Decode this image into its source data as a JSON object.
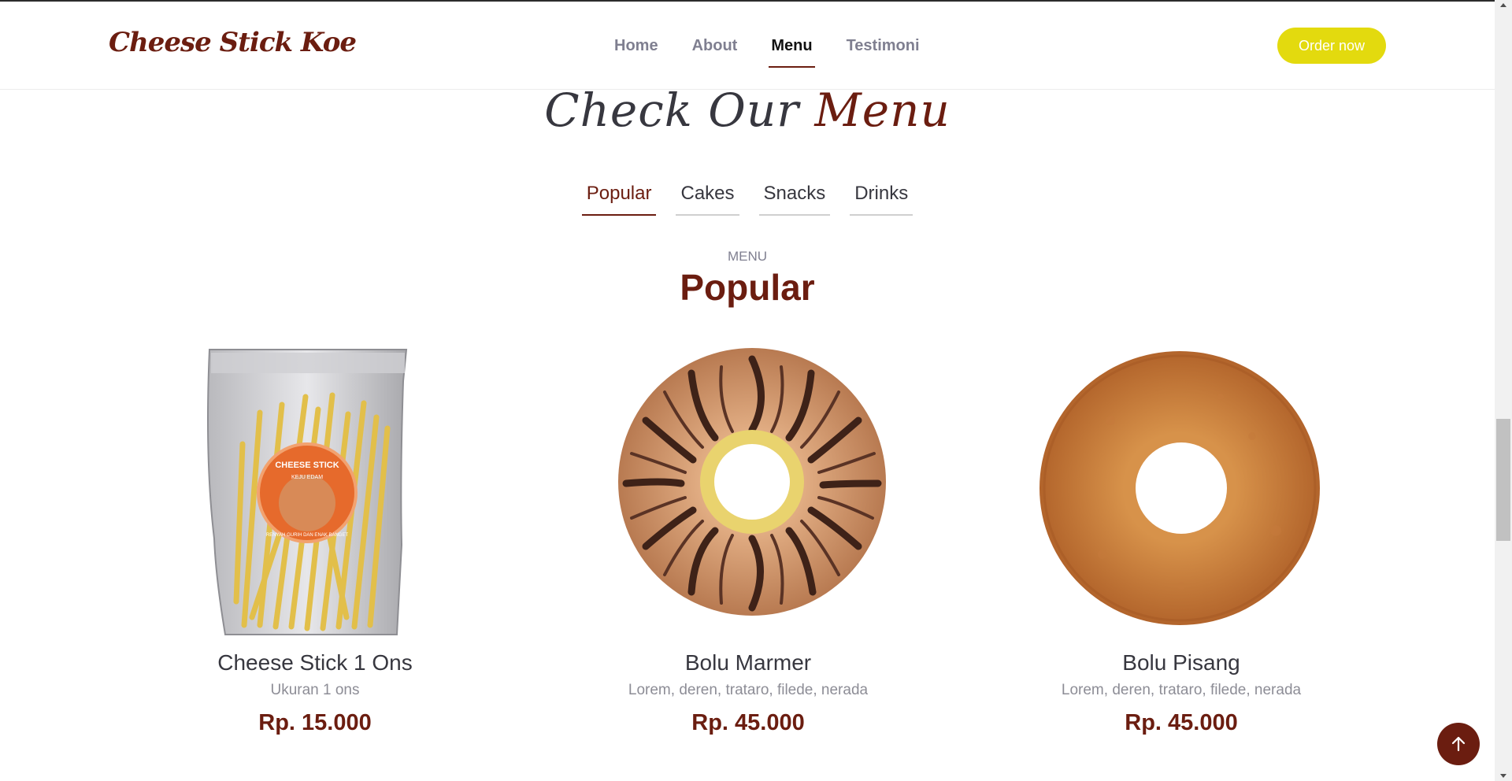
{
  "header": {
    "logo": "Cheese Stick Koe",
    "nav": [
      "Home",
      "About",
      "Menu",
      "Testimoni"
    ],
    "active_nav": "Menu",
    "order_label": "Order now"
  },
  "section": {
    "title_main": "Check Our",
    "title_accent": "Menu"
  },
  "tabs": [
    "Popular",
    "Cakes",
    "Snacks",
    "Drinks"
  ],
  "menu": {
    "label": "MENU",
    "heading": "Popular"
  },
  "items": [
    {
      "name": "Cheese Stick 1 Ons",
      "desc": "Ukuran 1 ons",
      "price": "Rp. 15.000",
      "sticker_title": "CHEESE STICK",
      "sticker_sub": "KEJU EDAM",
      "sticker_arc": "RENYAH GURIH DAN ENAK BANGET"
    },
    {
      "name": "Bolu Marmer",
      "desc": "Lorem, deren, trataro, filede, nerada",
      "price": "Rp. 45.000"
    },
    {
      "name": "Bolu Pisang",
      "desc": "Lorem, deren, trataro, filede, nerada",
      "price": "Rp. 45.000"
    }
  ],
  "colors": {
    "brand": "#6b1d10",
    "button": "#e3da0e",
    "text": "#37373f",
    "muted": "#8d8d96"
  },
  "icons": {
    "back_to_top": "arrow-up-icon"
  }
}
